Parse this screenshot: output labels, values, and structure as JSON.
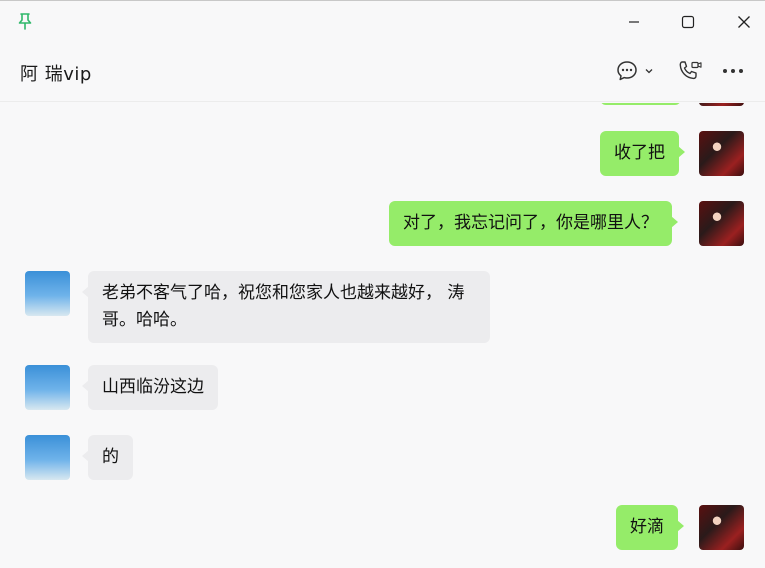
{
  "window": {
    "pin_icon": "pin-icon",
    "minimize_icon": "minimize-icon",
    "maximize_icon": "maximize-icon",
    "close_icon": "close-icon"
  },
  "header": {
    "title": "阿 瑞vip",
    "icons": [
      "chat-bubble-icon",
      "chevron-down-icon",
      "video-call-icon",
      "more-icon"
    ]
  },
  "colors": {
    "my_bubble": "#95ec69",
    "their_bubble": "#ececee",
    "accent_pin": "#2fb86a"
  },
  "messages": [
    {
      "side": "me",
      "text": "收了把"
    },
    {
      "side": "me",
      "text": "对了，我忘记问了，你是哪里人？"
    },
    {
      "side": "them",
      "text": "老弟不客气了哈，祝您和您家人也越来越好， 涛哥。哈哈。"
    },
    {
      "side": "them",
      "text": "山西临汾这边"
    },
    {
      "side": "them",
      "text": "的"
    },
    {
      "side": "me",
      "text": "好滴"
    }
  ]
}
